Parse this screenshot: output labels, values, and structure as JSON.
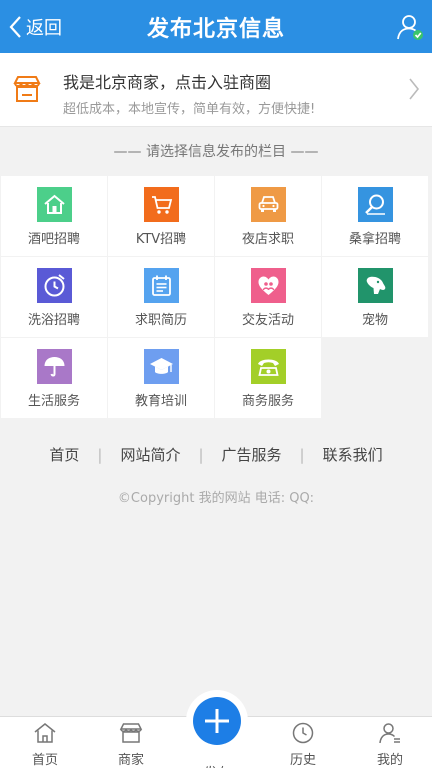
{
  "header": {
    "back_label": "返回",
    "title": "发布北京信息"
  },
  "banner": {
    "title": "我是北京商家，点击入驻商圈",
    "subtitle": "超低成本，本地宣传，简单有效，方便快捷!"
  },
  "section": {
    "title": "—— 请选择信息发布的栏目 ——"
  },
  "categories": [
    {
      "label": "酒吧招聘",
      "color": "#4ccf8a",
      "icon": "home-icon"
    },
    {
      "label": "KTV招聘",
      "color": "#f26c1c",
      "icon": "cart-icon"
    },
    {
      "label": "夜店求职",
      "color": "#ef9a45",
      "icon": "car-icon"
    },
    {
      "label": "桑拿招聘",
      "color": "#3594e0",
      "icon": "magnifier-icon"
    },
    {
      "label": "洗浴招聘",
      "color": "#5a5ad6",
      "icon": "clock-icon"
    },
    {
      "label": "求职简历",
      "color": "#55a3ef",
      "icon": "calendar-icon"
    },
    {
      "label": "交友活动",
      "color": "#ef5f8c",
      "icon": "heart-people-icon"
    },
    {
      "label": "宠物",
      "color": "#21946b",
      "icon": "dog-icon"
    },
    {
      "label": "生活服务",
      "color": "#a978c8",
      "icon": "umbrella-icon"
    },
    {
      "label": "教育培训",
      "color": "#6e9ef0",
      "icon": "graduation-cap-icon"
    },
    {
      "label": "商务服务",
      "color": "#a3cf28",
      "icon": "phone-icon"
    }
  ],
  "footer": {
    "links": [
      "首页",
      "网站简介",
      "广告服务",
      "联系我们"
    ],
    "copyright": "©Copyright  我的网站 电话:      QQ:"
  },
  "bottom_nav": {
    "home": "首页",
    "merchant": "商家",
    "publish": "发布",
    "history": "历史",
    "mine": "我的"
  },
  "colors": {
    "primary": "#2b8fe3",
    "fab": "#1d7ee6",
    "shop_orange": "#f07b16"
  }
}
